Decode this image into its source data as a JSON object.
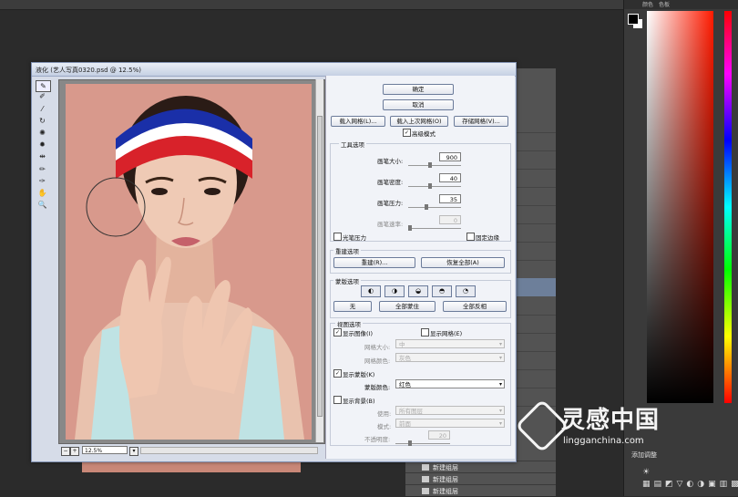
{
  "background": {
    "right_dock": {
      "tab_1": "颜色",
      "tab_2": "色板",
      "adjust_label": "添加调整"
    },
    "layers": [
      {
        "label": "新建组层"
      },
      {
        "label": "新建组层"
      },
      {
        "label": "新建组层"
      }
    ]
  },
  "dialog": {
    "title": "液化 (艺人写真0320.psd @ 12.5%)",
    "zoom_value": "12.5%",
    "buttons": {
      "ok": "确定",
      "cancel": "取消",
      "load_mesh": "载入网格(L)...",
      "load_last_mesh": "载入上次网格(O)",
      "save_mesh": "存储网格(V)...",
      "reconstruct": "重建(R)...",
      "restore_all": "恢复全部(A)",
      "none": "无",
      "mask_all": "全部蒙住",
      "invert_all": "全部反相"
    },
    "advanced_mode": "高级模式",
    "tool_options": {
      "title": "工具选项",
      "brush_size_label": "画笔大小:",
      "brush_size": "900",
      "brush_density_label": "画笔密度:",
      "brush_density": "40",
      "brush_pressure_label": "画笔压力:",
      "brush_pressure": "35",
      "brush_rate_label": "画笔速率:",
      "brush_rate": "0",
      "stylus_pressure": "光笔压力",
      "pin_edges": "固定边缘"
    },
    "reconstruct_options": {
      "title": "重建选项"
    },
    "mask_options": {
      "title": "蒙版选项"
    },
    "view_options": {
      "title": "视图选项",
      "show_image": "显示图像(I)",
      "show_mesh": "显示网格(E)",
      "mesh_size_label": "网格大小:",
      "mesh_size": "中",
      "mesh_color_label": "网格颜色:",
      "mesh_color": "灰色",
      "show_mask": "显示蒙版(K)",
      "mask_color_label": "蒙版颜色:",
      "mask_color": "红色",
      "show_backdrop": "显示背景(B)",
      "use_label": "使用:",
      "use_value": "所有图层",
      "mode_label": "模式:",
      "mode_value": "前面",
      "opacity_label": "不透明度:",
      "opacity": "20"
    }
  },
  "watermark": {
    "main": "灵感中国",
    "sub": "lingganchina.com"
  },
  "colors": {
    "accent_red": "#ff1a00",
    "headband_blue": "#1a2fa8",
    "headband_red": "#d8222a",
    "backdrop": "#d8998c"
  }
}
